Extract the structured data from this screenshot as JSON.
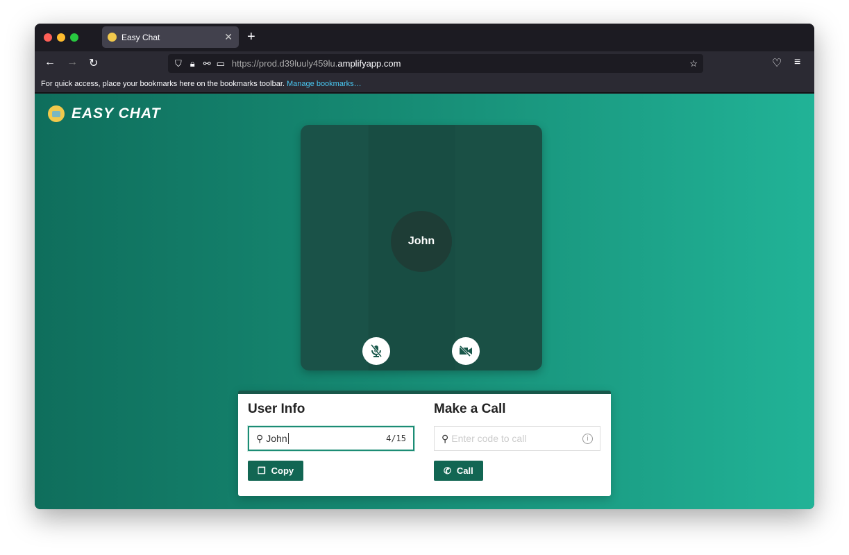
{
  "browser": {
    "tab_title": "Easy Chat",
    "url_prefix": "https://prod.d39luuly459lu.",
    "url_domain": "amplifyapp.com",
    "bookmarks_text": "For quick access, place your bookmarks here on the bookmarks toolbar.",
    "manage_bookmarks": "Manage bookmarks…"
  },
  "app": {
    "logo": "EASY CHAT",
    "video": {
      "name": "John"
    },
    "user_info": {
      "title": "User Info",
      "name_value": "John",
      "counter": "4/15",
      "copy_label": "Copy"
    },
    "make_call": {
      "title": "Make a Call",
      "placeholder": "Enter code to call",
      "call_label": "Call"
    }
  },
  "colors": {
    "accent": "#126653",
    "card": "#1a5045"
  }
}
